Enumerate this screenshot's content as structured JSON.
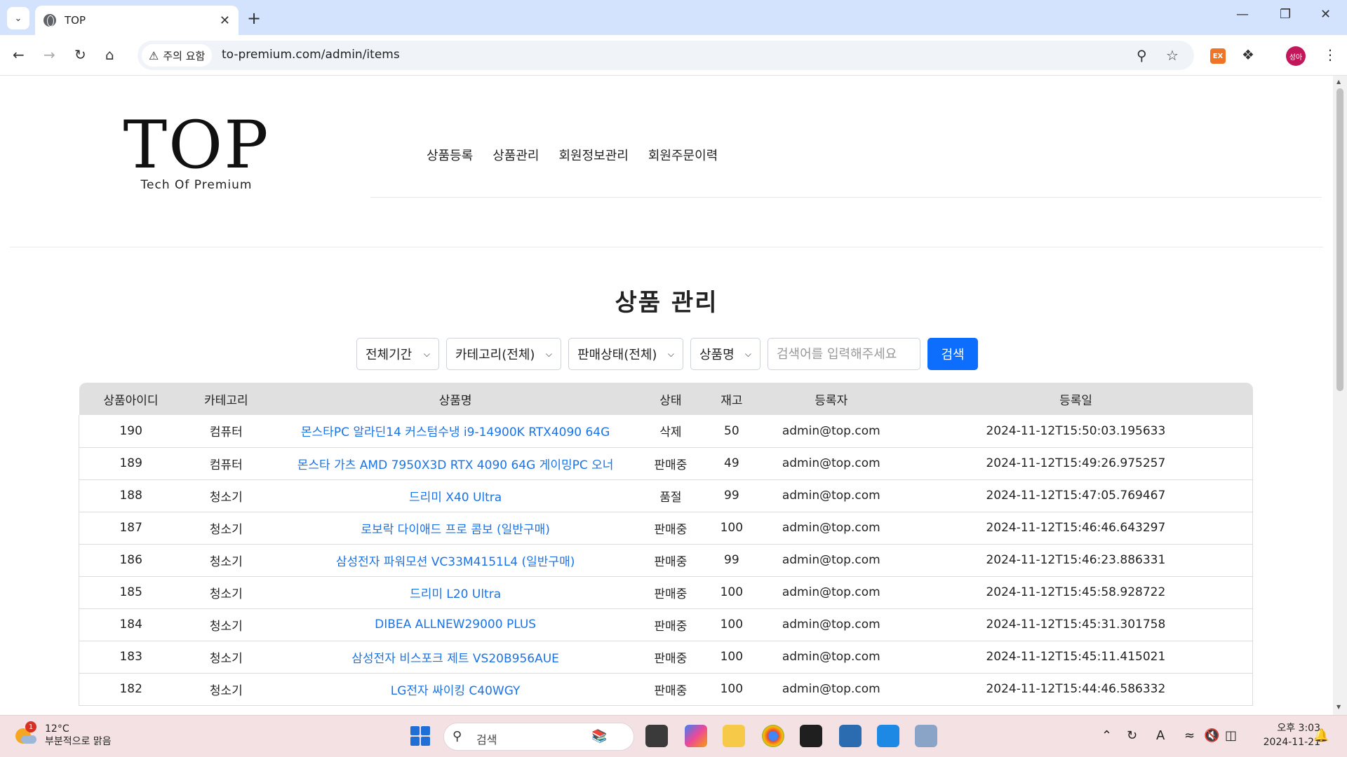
{
  "browser": {
    "tab_title": "TOP",
    "security_label": "주의 요함",
    "url": "to-premium.com/admin/items",
    "profile_label": "성아",
    "extension_label": "EX"
  },
  "site": {
    "logo_main": "TOP",
    "logo_sub": "Tech Of Premium",
    "nav": [
      "상품등록",
      "상품관리",
      "회원정보관리",
      "회원주문이력"
    ]
  },
  "page": {
    "title": "상품 관리",
    "filters": {
      "period": "전체기간",
      "category": "카테고리(전체)",
      "status": "판매상태(전체)",
      "field": "상품명",
      "search_placeholder": "검색어를 입력해주세요",
      "search_button": "검색"
    }
  },
  "table": {
    "headers": [
      "상품아이디",
      "카테고리",
      "상품명",
      "상태",
      "재고",
      "등록자",
      "등록일"
    ],
    "rows": [
      {
        "id": "190",
        "category": "컴퓨터",
        "name": "몬스타PC 알라딘14 커스텀수냉 i9-14900K RTX4090 64G",
        "status": "삭제",
        "stock": "50",
        "registrant": "admin@top.com",
        "date": "2024-11-12T15:50:03.195633"
      },
      {
        "id": "189",
        "category": "컴퓨터",
        "name": "몬스타 가츠 AMD 7950X3D RTX 4090 64G 게이밍PC 오너",
        "status": "판매중",
        "stock": "49",
        "registrant": "admin@top.com",
        "date": "2024-11-12T15:49:26.975257"
      },
      {
        "id": "188",
        "category": "청소기",
        "name": "드리미 X40 Ultra",
        "status": "품절",
        "stock": "99",
        "registrant": "admin@top.com",
        "date": "2024-11-12T15:47:05.769467"
      },
      {
        "id": "187",
        "category": "청소기",
        "name": "로보락 다이애드 프로 콤보 (일반구매)",
        "status": "판매중",
        "stock": "100",
        "registrant": "admin@top.com",
        "date": "2024-11-12T15:46:46.643297"
      },
      {
        "id": "186",
        "category": "청소기",
        "name": "삼성전자 파워모션 VC33M4151L4 (일반구매)",
        "status": "판매중",
        "stock": "99",
        "registrant": "admin@top.com",
        "date": "2024-11-12T15:46:23.886331"
      },
      {
        "id": "185",
        "category": "청소기",
        "name": "드리미 L20 Ultra",
        "status": "판매중",
        "stock": "100",
        "registrant": "admin@top.com",
        "date": "2024-11-12T15:45:58.928722"
      },
      {
        "id": "184",
        "category": "청소기",
        "name": "DIBEA ALLNEW29000 PLUS",
        "status": "판매중",
        "stock": "100",
        "registrant": "admin@top.com",
        "date": "2024-11-12T15:45:31.301758"
      },
      {
        "id": "183",
        "category": "청소기",
        "name": "삼성전자 비스포크 제트 VS20B956AUE",
        "status": "판매중",
        "stock": "100",
        "registrant": "admin@top.com",
        "date": "2024-11-12T15:45:11.415021"
      },
      {
        "id": "182",
        "category": "청소기",
        "name": "LG전자 싸이킹 C40WGY",
        "status": "판매중",
        "stock": "100",
        "registrant": "admin@top.com",
        "date": "2024-11-12T15:44:46.586332"
      }
    ]
  },
  "taskbar": {
    "weather_temp": "12°C",
    "weather_desc": "부분적으로 맑음",
    "weather_badge": "1",
    "search_label": "검색",
    "time": "오후 3:03",
    "date": "2024-11-21"
  },
  "colors": {
    "accent": "#0d6efd",
    "link": "#1a73e8",
    "tabbar": "#d3e3fd",
    "taskbar": "#f3e1e4",
    "table_header": "#e0e0e0"
  }
}
